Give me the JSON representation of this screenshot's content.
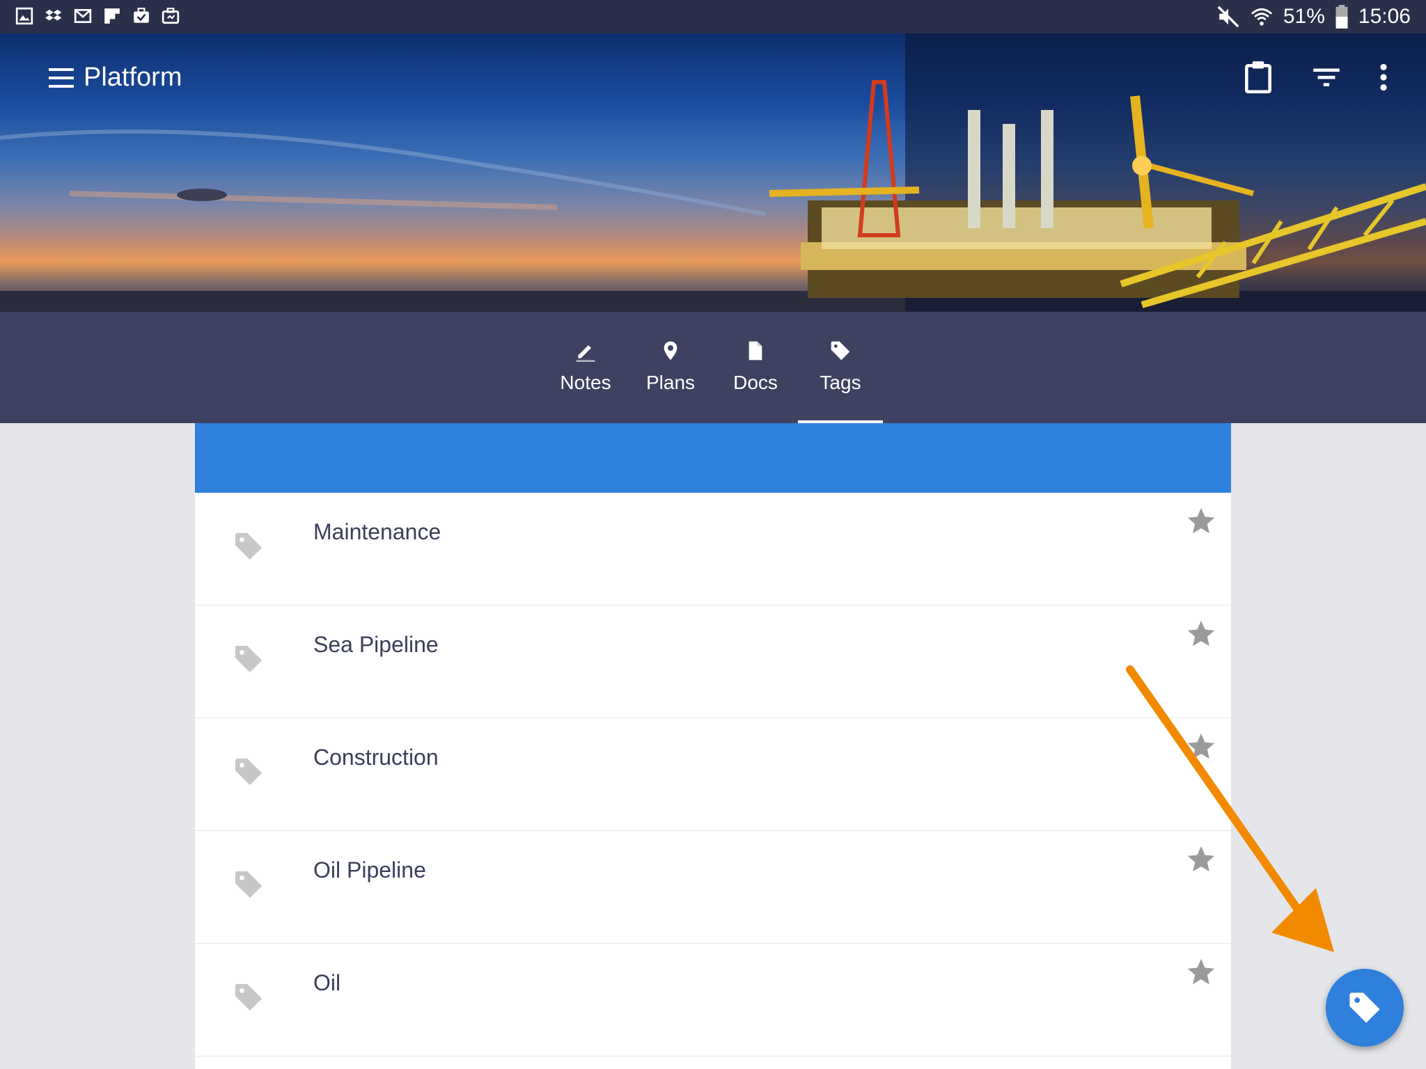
{
  "status_bar": {
    "battery": "51%",
    "time": "15:06",
    "left_icons": [
      "gallery-icon",
      "dropbox-icon",
      "gmail-icon",
      "flipboard-icon",
      "briefcase-check-icon",
      "briefcase-sync-icon"
    ],
    "right_icons": [
      "mute-icon",
      "wifi-icon",
      "battery-icon"
    ]
  },
  "app_bar": {
    "title": "Platform",
    "actions": [
      "clipboard-icon",
      "filter-icon",
      "more-vert-icon"
    ]
  },
  "tabs": [
    {
      "label": "Notes",
      "icon": "pencil-icon"
    },
    {
      "label": "Plans",
      "icon": "pin-icon"
    },
    {
      "label": "Docs",
      "icon": "document-icon"
    },
    {
      "label": "Tags",
      "icon": "tag-icon",
      "selected": true
    }
  ],
  "tags": [
    {
      "label": "Maintenance"
    },
    {
      "label": "Sea Pipeline"
    },
    {
      "label": "Construction"
    },
    {
      "label": "Oil Pipeline"
    },
    {
      "label": "Oil"
    }
  ],
  "fab": {
    "icon": "tag-icon"
  },
  "colors": {
    "status_bar": "#2a2f4a",
    "tab_bar": "#3e4260",
    "accent": "#2f7fdd",
    "annotation_arrow": "#f28a00"
  }
}
